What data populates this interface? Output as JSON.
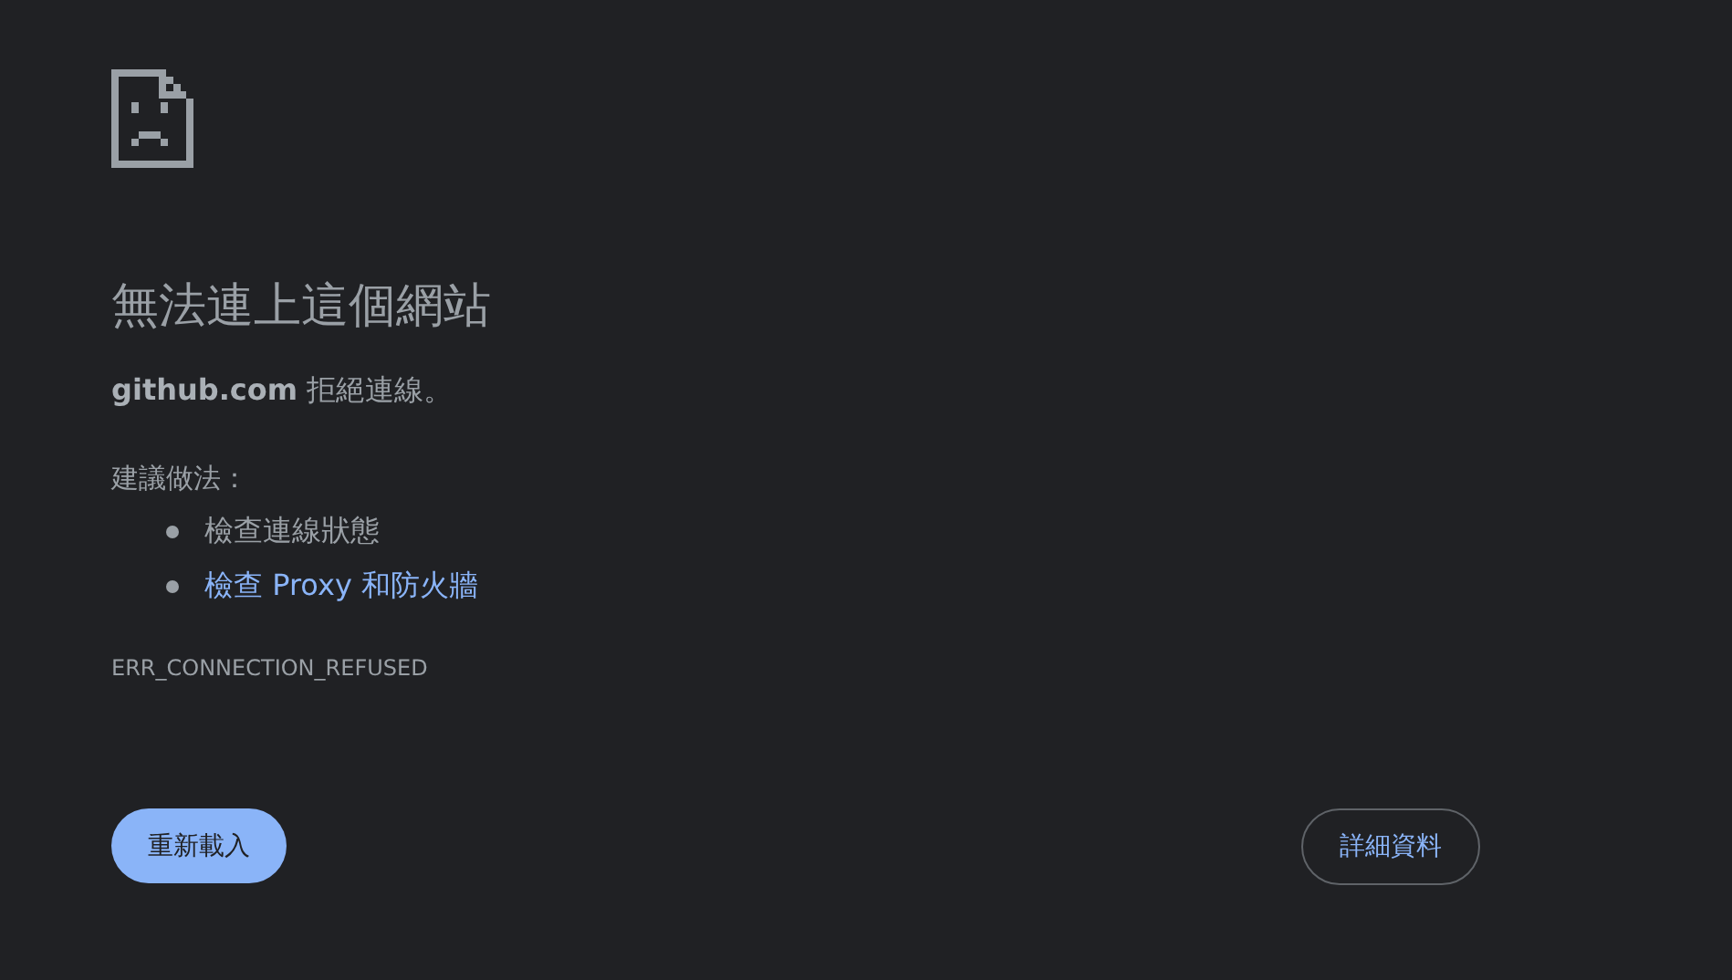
{
  "heading": "無法連上這個網站",
  "summary": "**github.com** 拒絕連線。",
  "suggestions_label": "建議做法：",
  "suggestions": [
    {
      "kind": "text",
      "label": "檢查連線狀態"
    },
    {
      "kind": "link",
      "label": "檢查 Proxy 和防火牆"
    }
  ],
  "error_code": "ERR_CONNECTION_REFUSED",
  "buttons": [
    {
      "kind": "primary",
      "label": "重新載入"
    },
    {
      "kind": "outline",
      "label": "詳細資料"
    }
  ]
}
